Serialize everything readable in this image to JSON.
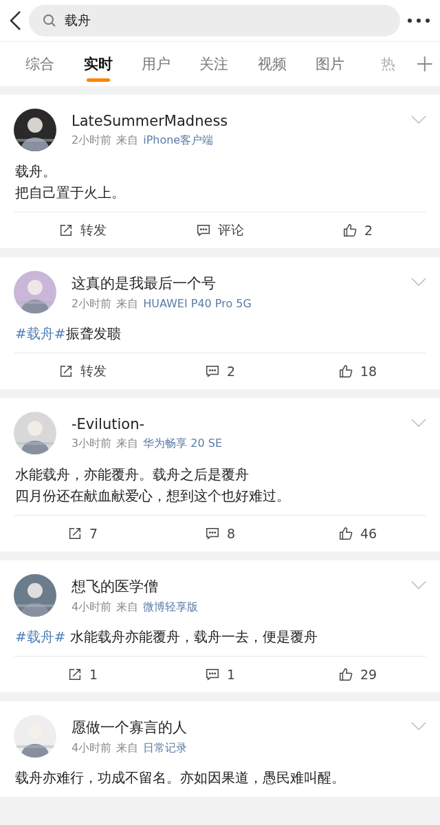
{
  "search": {
    "value": "载舟"
  },
  "tabs": [
    {
      "label": "综合",
      "selected": false,
      "faded": false
    },
    {
      "label": "实时",
      "selected": true,
      "faded": false
    },
    {
      "label": "用户",
      "selected": false,
      "faded": false
    },
    {
      "label": "关注",
      "selected": false,
      "faded": false
    },
    {
      "label": "视频",
      "selected": false,
      "faded": false
    },
    {
      "label": "图片",
      "selected": false,
      "faded": false
    },
    {
      "label": "热",
      "selected": false,
      "faded": true
    }
  ],
  "posts": [
    {
      "author": "LateSummerMadness",
      "time": "2小时前",
      "via": "来自",
      "source": "iPhone客户端",
      "body": [
        [
          {
            "kind": "text",
            "text": "载舟。"
          }
        ],
        [
          {
            "kind": "text",
            "text": "把自己置于火上。"
          }
        ]
      ],
      "actions": [
        {
          "kind": "repost",
          "label": "转发"
        },
        {
          "kind": "comment",
          "label": "评论"
        },
        {
          "kind": "like",
          "label": "2"
        }
      ]
    },
    {
      "author": "这真的是我最后一个号",
      "time": "2小时前",
      "via": "来自",
      "source": "HUAWEI P40 Pro 5G",
      "body": [
        [
          {
            "kind": "hashtag",
            "text": "#载舟#"
          },
          {
            "kind": "text",
            "text": "振聋发聩"
          }
        ]
      ],
      "actions": [
        {
          "kind": "repost",
          "label": "转发"
        },
        {
          "kind": "comment",
          "label": "2"
        },
        {
          "kind": "like",
          "label": "18"
        }
      ]
    },
    {
      "author": "-Evilution-",
      "time": "3小时前",
      "via": "来自",
      "source": "华为畅享 20 SE",
      "body": [
        [
          {
            "kind": "text",
            "text": "水能载舟，亦能覆舟。载舟之后是覆舟"
          }
        ],
        [
          {
            "kind": "text",
            "text": "四月份还在献血献爱心，想到这个也好难过。"
          }
        ]
      ],
      "actions": [
        {
          "kind": "repost",
          "label": "7"
        },
        {
          "kind": "comment",
          "label": "8"
        },
        {
          "kind": "like",
          "label": "46"
        }
      ]
    },
    {
      "author": "想飞的医学僧",
      "time": "4小时前",
      "via": "来自",
      "source": "微博轻享版",
      "body": [
        [
          {
            "kind": "hashtag",
            "text": "#载舟#"
          },
          {
            "kind": "text",
            "text": " 水能载舟亦能覆舟，载舟一去，便是覆舟"
          }
        ]
      ],
      "actions": [
        {
          "kind": "repost",
          "label": "1"
        },
        {
          "kind": "comment",
          "label": "1"
        },
        {
          "kind": "like",
          "label": "29"
        }
      ]
    },
    {
      "author": "愿做一个寡言的人",
      "time": "4小时前",
      "via": "来自",
      "source": "日常记录",
      "body": [
        [
          {
            "kind": "text",
            "text": "载舟亦难行，功成不留名。亦如因果道，愚民难叫醒。"
          }
        ]
      ]
    }
  ]
}
